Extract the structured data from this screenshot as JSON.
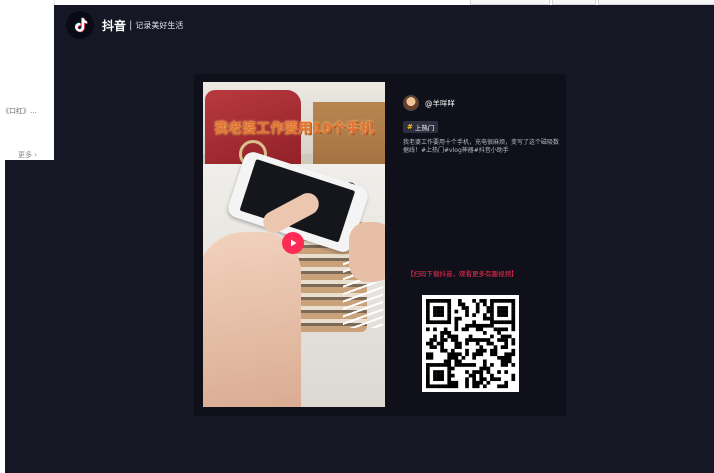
{
  "background": {
    "snippet_text": "《口红》…",
    "more_link": "更多 ›"
  },
  "brand": {
    "name": "抖音",
    "separator": "|",
    "slogan": "记录美好生活"
  },
  "video": {
    "caption": "我老婆工作要用10个手机",
    "play_icon": "play-icon"
  },
  "post": {
    "author": "@羊咩咩",
    "tag": "上热门",
    "description": "我老婆工作要用十个手机，充电很麻烦，变写了这个磁吸数据线！#上热门#vlog神器#抖音小助手"
  },
  "download": {
    "promo": "【扫码下载抖音，观看更多有趣视频】"
  },
  "colors": {
    "overlay_bg": "#161724",
    "card_bg": "#0f1019",
    "accent": "#fe2c55",
    "tag_hash": "#f5c518"
  }
}
